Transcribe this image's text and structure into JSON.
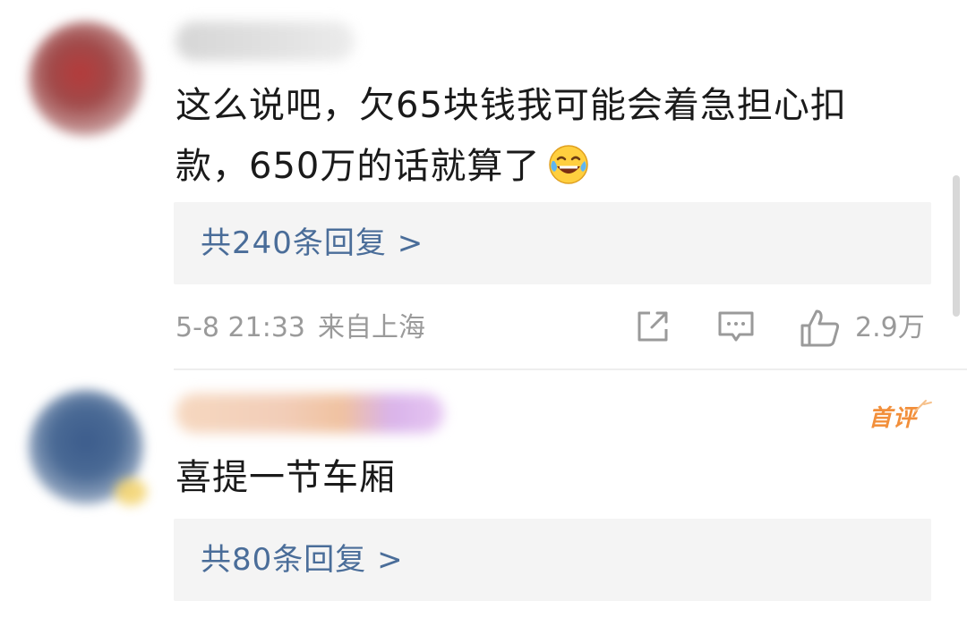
{
  "comments": [
    {
      "text_line1": "这么说吧，欠65块钱我可能会着急担心扣",
      "text_line2": "款，650万的话就算了",
      "emoji": "laughing-tears-icon",
      "replies_label": "共240条回复 >",
      "meta": {
        "date": "5-8 21:33",
        "location": "来自上海"
      },
      "actions": {
        "share_icon": "share-icon",
        "reply_icon": "comment-icon",
        "like_icon": "thumbs-up-icon",
        "like_count": "2.9万"
      }
    },
    {
      "badge": "首评",
      "text": "喜提一节车厢",
      "replies_label": "共80条回复 >"
    }
  ],
  "colors": {
    "link": "#4a6d99",
    "meta": "#9a9a9a",
    "reply_box_bg": "#f4f4f4",
    "badge": "#f28f3b"
  }
}
